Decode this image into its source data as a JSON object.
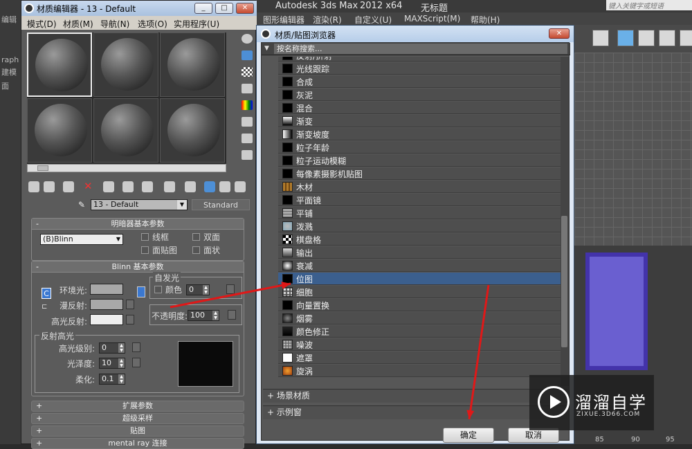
{
  "background_app": {
    "title_parts": [
      "Autodesk 3ds Max",
      "2012 x64",
      "无标题"
    ],
    "search_placeholder": "键入关键字或短语",
    "menu": [
      "图形编辑器",
      "渲染(R)",
      "自定义(U)",
      "MAXScript(M)",
      "帮助(H)"
    ],
    "left_labels": [
      "编辑",
      "raph",
      "建模",
      "面"
    ],
    "ruler_numbers": [
      "85",
      "90",
      "95"
    ]
  },
  "material_editor": {
    "title": "材质编辑器 - 13 - Default",
    "window_buttons": [
      "_",
      "□",
      "✕"
    ],
    "menu": [
      "模式(D)",
      "材质(M)",
      "导航(N)",
      "选项(O)",
      "实用程序(U)"
    ],
    "material_name": "13 - Default",
    "material_type": "Standard",
    "shader_rollout": {
      "title": "明暗器基本参数",
      "shader": "(B)Blinn",
      "checkboxes": [
        "线框",
        "双面",
        "面贴图",
        "面状"
      ]
    },
    "blinn_rollout": {
      "title": "Blinn 基本参数",
      "ambient": "环境光:",
      "diffuse": "漫反射:",
      "specular": "高光反射:",
      "self_illum_title": "自发光",
      "color_label": "颜色",
      "color_value": "0",
      "opacity_label": "不透明度:",
      "opacity_value": "100",
      "lock_c": "C"
    },
    "spec_highlights": {
      "title": "反射高光",
      "level_label": "高光级别:",
      "level_value": "0",
      "gloss_label": "光泽度:",
      "gloss_value": "10",
      "soften_label": "柔化:",
      "soften_value": "0.1"
    },
    "collapsed_rollouts": [
      "扩展参数",
      "超级采样",
      "贴图",
      "mental ray 连接"
    ]
  },
  "browser": {
    "title": "材质/贴图浏览器",
    "search_placeholder": "按名称搜索...",
    "items": [
      {
        "label": "反射/折射",
        "icon": "reflect-refract-icon"
      },
      {
        "label": "光线跟踪",
        "icon": "raytrace-icon"
      },
      {
        "label": "合成",
        "icon": "composite-icon"
      },
      {
        "label": "灰泥",
        "icon": "stucco-icon"
      },
      {
        "label": "混合",
        "icon": "mix-icon"
      },
      {
        "label": "渐变",
        "icon": "gradient-icon"
      },
      {
        "label": "渐变坡度",
        "icon": "gradient-ramp-icon"
      },
      {
        "label": "粒子年龄",
        "icon": "particle-age-icon"
      },
      {
        "label": "粒子运动模糊",
        "icon": "particle-mblur-icon"
      },
      {
        "label": "每像素摄影机贴图",
        "icon": "camera-map-icon"
      },
      {
        "label": "木材",
        "icon": "wood-icon"
      },
      {
        "label": "平面镜",
        "icon": "flat-mirror-icon"
      },
      {
        "label": "平铺",
        "icon": "tiles-icon"
      },
      {
        "label": "泼溅",
        "icon": "splat-icon"
      },
      {
        "label": "棋盘格",
        "icon": "checker-icon"
      },
      {
        "label": "输出",
        "icon": "output-icon"
      },
      {
        "label": "衰减",
        "icon": "falloff-icon"
      },
      {
        "label": "位图",
        "icon": "bitmap-icon",
        "selected": true
      },
      {
        "label": "细胞",
        "icon": "cellular-icon"
      },
      {
        "label": "向量置换",
        "icon": "vector-displacement-icon"
      },
      {
        "label": "烟雾",
        "icon": "smoke-icon"
      },
      {
        "label": "颜色修正",
        "icon": "color-correction-icon"
      },
      {
        "label": "噪波",
        "icon": "noise-icon"
      },
      {
        "label": "遮罩",
        "icon": "mask-icon"
      },
      {
        "label": "旋涡",
        "icon": "swirl-icon"
      }
    ],
    "groups": [
      "+ 场景材质",
      "+ 示例窗"
    ],
    "ok": "确定",
    "cancel": "取消"
  },
  "watermark": {
    "name": "溜溜自学",
    "url": "ZIXUE.3D66.COM"
  },
  "colors": {
    "annotation_red": "#e01818",
    "selection_blue": "#3b5f8e"
  }
}
